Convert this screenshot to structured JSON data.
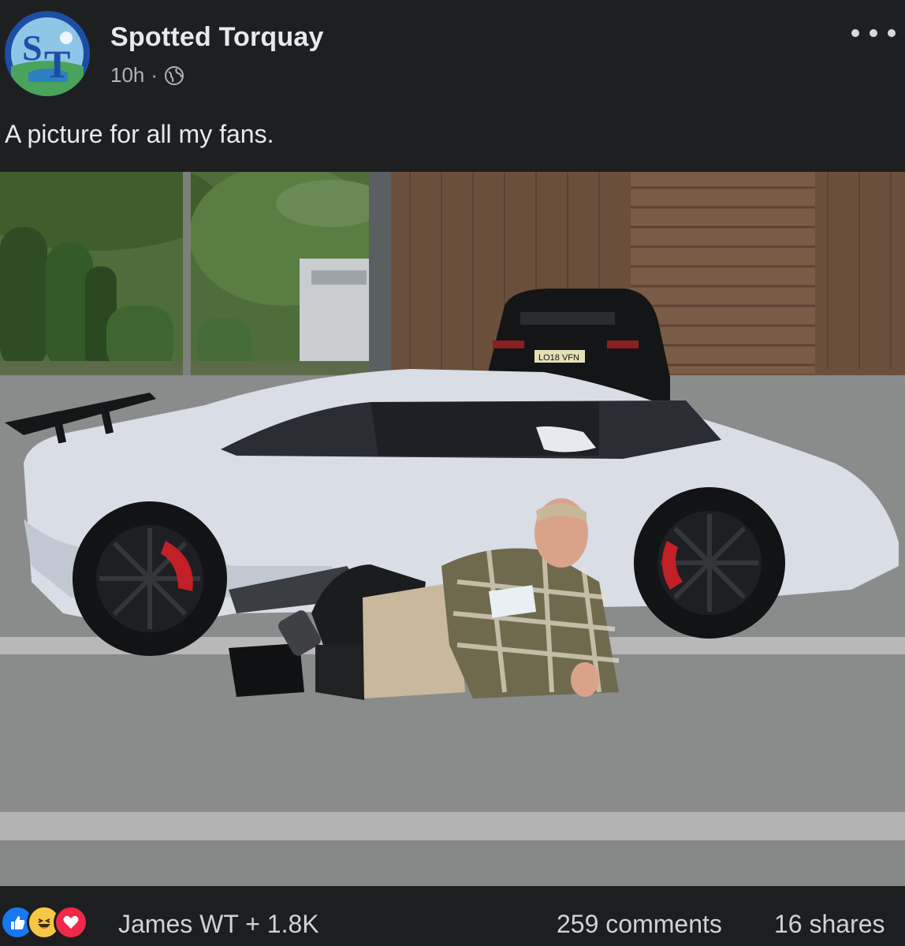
{
  "post": {
    "page_name": "Spotted Torquay",
    "time": "10h",
    "separator": "·",
    "visibility_icon": "globe-icon",
    "text": "A picture for all my fans.",
    "avatar_monogram": "ST"
  },
  "photo": {
    "license_plate": "LO18 VFN"
  },
  "engagement": {
    "reaction_icons": [
      "like-icon",
      "haha-icon",
      "love-icon"
    ],
    "reactors": "James WT + 1.8K",
    "comments": "259 comments",
    "shares": "16 shares"
  },
  "colors": {
    "like": "#1877f2",
    "haha": "#f7c843",
    "love": "#f02849",
    "avatar_ring": "#1f4fa8"
  }
}
